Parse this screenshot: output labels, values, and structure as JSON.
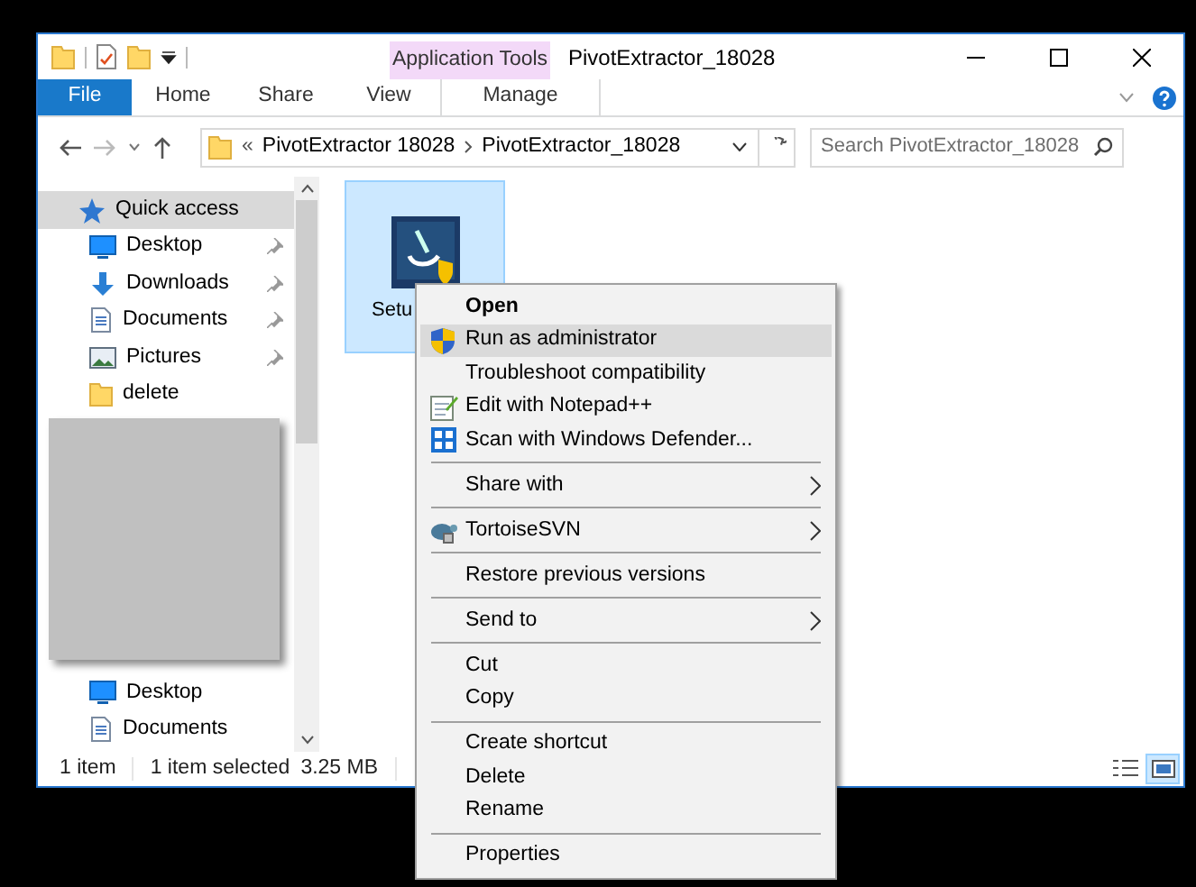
{
  "window": {
    "title": "PivotExtractor_18028"
  },
  "ribbon": {
    "context_group": "Application Tools",
    "tabs": [
      {
        "label": "File",
        "kind": "file"
      },
      {
        "label": "Home",
        "kind": "plain"
      },
      {
        "label": "Share",
        "kind": "plain"
      },
      {
        "label": "View",
        "kind": "plain"
      },
      {
        "label": "Manage",
        "kind": "context"
      }
    ]
  },
  "address_bar": {
    "overflow": "«",
    "breadcrumbs": [
      "PivotExtractor 18028",
      "PivotExtractor_18028"
    ]
  },
  "search": {
    "placeholder": "Search PivotExtractor_18028"
  },
  "sidebar": {
    "items": [
      {
        "label": "Quick access",
        "kind": "star",
        "selected": true,
        "pinned": false
      },
      {
        "label": "Desktop",
        "kind": "desktop",
        "selected": false,
        "pinned": true
      },
      {
        "label": "Downloads",
        "kind": "download",
        "selected": false,
        "pinned": true
      },
      {
        "label": "Documents",
        "kind": "document",
        "selected": false,
        "pinned": true
      },
      {
        "label": "Pictures",
        "kind": "picture",
        "selected": false,
        "pinned": true
      },
      {
        "label": "delete",
        "kind": "folder",
        "selected": false,
        "pinned": false
      },
      {
        "kind": "redacted"
      },
      {
        "label": "Desktop",
        "kind": "desktop",
        "selected": false,
        "pinned": false
      },
      {
        "label": "Documents",
        "kind": "document",
        "selected": false,
        "pinned": false
      }
    ]
  },
  "files": [
    {
      "name": "Setu",
      "selected": true
    }
  ],
  "context_menu": {
    "groups": [
      [
        {
          "label": "Open",
          "default": true,
          "highlighted": false,
          "submenu": false
        },
        {
          "label": "Run as administrator",
          "kind": "shield",
          "default": false,
          "highlighted": true,
          "submenu": false
        },
        {
          "label": "Troubleshoot compatibility",
          "default": false,
          "highlighted": false,
          "submenu": false
        },
        {
          "label": "Edit with Notepad++",
          "kind": "notepad",
          "default": false,
          "highlighted": false,
          "submenu": false
        },
        {
          "label": "Scan with Windows Defender...",
          "kind": "defender",
          "default": false,
          "highlighted": false,
          "submenu": false
        }
      ],
      [
        {
          "label": "Share with",
          "default": false,
          "highlighted": false,
          "submenu": true
        }
      ],
      [
        {
          "label": "TortoiseSVN",
          "kind": "tortoise",
          "default": false,
          "highlighted": false,
          "submenu": true
        }
      ],
      [
        {
          "label": "Restore previous versions",
          "default": false,
          "highlighted": false,
          "submenu": false
        }
      ],
      [
        {
          "label": "Send to",
          "default": false,
          "highlighted": false,
          "submenu": true
        }
      ],
      [
        {
          "label": "Cut",
          "default": false,
          "highlighted": false,
          "submenu": false
        },
        {
          "label": "Copy",
          "default": false,
          "highlighted": false,
          "submenu": false
        }
      ],
      [
        {
          "label": "Create shortcut",
          "default": false,
          "highlighted": false,
          "submenu": false
        },
        {
          "label": "Delete",
          "default": false,
          "highlighted": false,
          "submenu": false
        },
        {
          "label": "Rename",
          "default": false,
          "highlighted": false,
          "submenu": false
        }
      ],
      [
        {
          "label": "Properties",
          "default": false,
          "highlighted": false,
          "submenu": false
        }
      ]
    ]
  },
  "status_bar": {
    "item_count": "1 item",
    "selection": "1 item selected",
    "size": "3.25 MB",
    "views": [
      {
        "kind": "details",
        "selected": false
      },
      {
        "kind": "large-icons",
        "selected": true
      }
    ]
  }
}
